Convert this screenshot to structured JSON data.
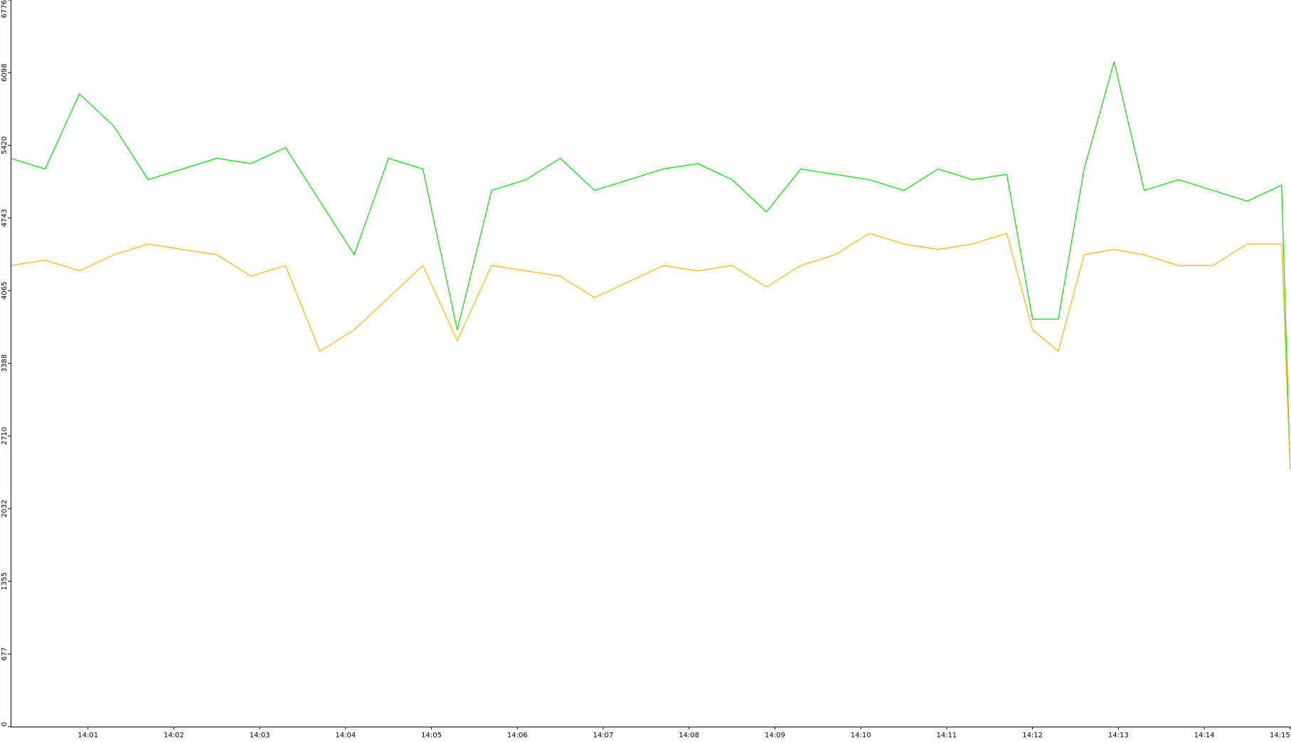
{
  "chart_data": {
    "type": "line",
    "title": "",
    "xlabel": "",
    "ylabel": "",
    "ylim": [
      0,
      6776
    ],
    "y_ticks": [
      "0",
      "677",
      "1355",
      "2032",
      "2710",
      "3388",
      "4065",
      "4743",
      "5420",
      "6098",
      "6776"
    ],
    "x_ticks": [
      "14:01",
      "14:02",
      "14:03",
      "14:04",
      "14:05",
      "14:06",
      "14:07",
      "14:08",
      "14:09",
      "14:10",
      "14:11",
      "14:12",
      "14:13",
      "14:14",
      "14:15"
    ],
    "x_range_minutes": [
      0.1,
      15.01
    ],
    "grid": false,
    "legend": "none",
    "series": [
      {
        "color": "#00e000",
        "x_minutes": [
          0.1,
          0.5,
          0.9,
          1.3,
          1.7,
          2.1,
          2.5,
          2.9,
          3.3,
          3.7,
          4.1,
          4.5,
          4.9,
          5.3,
          5.7,
          6.1,
          6.5,
          6.9,
          7.3,
          7.7,
          8.1,
          8.5,
          8.9,
          9.3,
          9.7,
          10.1,
          10.5,
          10.9,
          11.3,
          11.7,
          12.0,
          12.3,
          12.6,
          12.95,
          13.3,
          13.7,
          14.1,
          14.5,
          14.9,
          15.0
        ],
        "values": [
          5300,
          5200,
          5900,
          5600,
          5100,
          5200,
          5300,
          5250,
          5400,
          4900,
          4400,
          5300,
          5200,
          3700,
          5000,
          5100,
          5300,
          5000,
          5100,
          5200,
          5250,
          5100,
          4800,
          5200,
          5150,
          5100,
          5000,
          5200,
          5100,
          5150,
          3800,
          3800,
          5200,
          6200,
          5000,
          5100,
          5000,
          4900,
          5050,
          2400
        ]
      },
      {
        "color": "#ffb400",
        "x_minutes": [
          0.1,
          0.5,
          0.9,
          1.3,
          1.7,
          2.1,
          2.5,
          2.9,
          3.3,
          3.7,
          4.1,
          4.5,
          4.9,
          5.3,
          5.7,
          6.1,
          6.5,
          6.9,
          7.3,
          7.7,
          8.1,
          8.5,
          8.9,
          9.3,
          9.7,
          10.1,
          10.5,
          10.9,
          11.3,
          11.7,
          12.0,
          12.3,
          12.6,
          12.95,
          13.3,
          13.7,
          14.1,
          14.5,
          14.9,
          15.0
        ],
        "values": [
          4300,
          4350,
          4250,
          4400,
          4500,
          4450,
          4400,
          4200,
          4300,
          3500,
          3700,
          4000,
          4300,
          3600,
          4300,
          4250,
          4200,
          4000,
          4150,
          4300,
          4250,
          4300,
          4100,
          4300,
          4400,
          4600,
          4500,
          4450,
          4500,
          4600,
          3700,
          3500,
          4400,
          4450,
          4400,
          4300,
          4300,
          4500,
          4500,
          2400
        ]
      }
    ]
  }
}
